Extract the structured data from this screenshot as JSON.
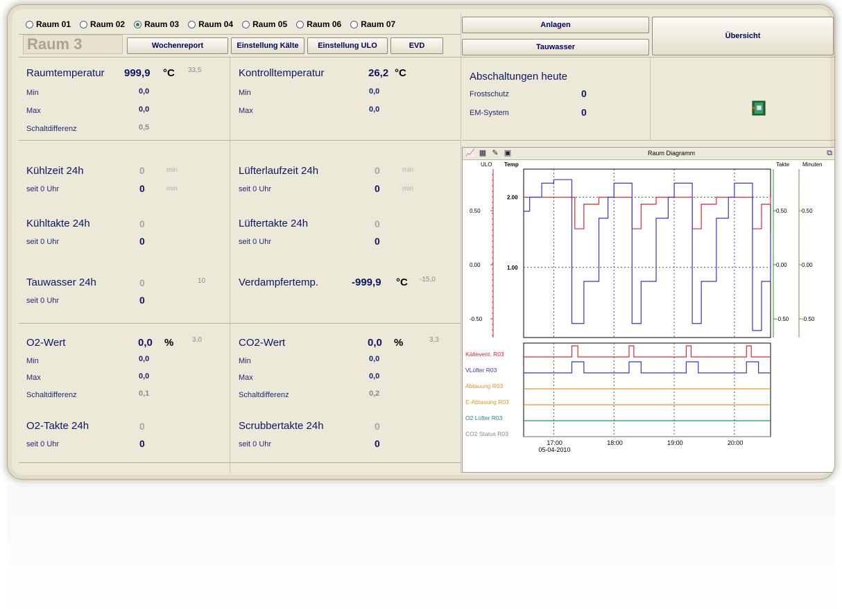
{
  "rooms": [
    {
      "label": "Raum 01",
      "selected": false
    },
    {
      "label": "Raum 02",
      "selected": false
    },
    {
      "label": "Raum 03",
      "selected": true
    },
    {
      "label": "Raum 04",
      "selected": false
    },
    {
      "label": "Raum 05",
      "selected": false
    },
    {
      "label": "Raum 06",
      "selected": false
    },
    {
      "label": "Raum 07",
      "selected": false
    }
  ],
  "header": {
    "room_title": "Raum 3",
    "btn_wochenreport": "Wochenreport",
    "btn_einstellung_kaelte": "Einstellung Kälte",
    "btn_einstellung_ulo": "Einstellung ULO",
    "btn_evd": "EVD",
    "btn_anlagen": "Anlagen",
    "btn_tauwasser": "Tauwasser",
    "btn_uebersicht": "Übersicht"
  },
  "raumtemp": {
    "title": "Raumtemperatur",
    "value": "999,9",
    "unit": "°C",
    "setpoint": "33,5",
    "min_label": "Min",
    "min": "0,0",
    "max_label": "Max",
    "max": "0,0",
    "diff_label": "Schaltdifferenz",
    "diff": "0,5"
  },
  "kontrolltemp": {
    "title": "Kontrolltemperatur",
    "value": "26,2",
    "unit": "°C",
    "min_label": "Min",
    "min": "0,0",
    "max_label": "Max",
    "max": "0,0"
  },
  "abschaltungen": {
    "title": "Abschaltungen heute",
    "frost_label": "Frostschutz",
    "frost": "0",
    "em_label": "EM-System",
    "em": "0"
  },
  "kuehlzeit": {
    "title": "Kühlzeit 24h",
    "value": "0",
    "unit": "min",
    "since_label": "seit 0 Uhr",
    "since": "0",
    "since_unit": "min"
  },
  "luefterlauf": {
    "title": "Lüfterlaufzeit 24h",
    "value": "0",
    "unit": "min",
    "since_label": "seit 0 Uhr",
    "since": "0",
    "since_unit": "min"
  },
  "kuehltakte": {
    "title": "Kühltakte 24h",
    "value": "0",
    "since_label": "seit 0 Uhr",
    "since": "0"
  },
  "luefertakte": {
    "title": "Lüftertakte 24h",
    "value": "0",
    "since_label": "seit 0 Uhr",
    "since": "0"
  },
  "tauwasser": {
    "title": "Tauwasser 24h",
    "value": "0",
    "setpoint": "10",
    "since_label": "seit 0 Uhr",
    "since": "0"
  },
  "verdampfer": {
    "title": "Verdampfertemp.",
    "value": "-999,9",
    "unit": "°C",
    "setpoint": "-15,0"
  },
  "o2": {
    "title": "O2-Wert",
    "value": "0,0",
    "unit": "%",
    "setpoint": "3,0",
    "min_label": "Min",
    "min": "0,0",
    "max_label": "Max",
    "max": "0,0",
    "diff_label": "Schaltdifferenz",
    "diff": "0,1"
  },
  "co2": {
    "title": "CO2-Wert",
    "value": "0,0",
    "unit": "%",
    "setpoint": "3,3",
    "min_label": "Min",
    "min": "0,0",
    "max_label": "Max",
    "max": "0,0",
    "diff_label": "Schaltdifferenz",
    "diff": "0,2"
  },
  "o2takte": {
    "title": "O2-Takte 24h",
    "value": "0",
    "since_label": "seit 0 Uhr",
    "since": "0"
  },
  "scrubber": {
    "title": "Scrubbertakte 24h",
    "value": "0",
    "since_label": "seit 0 Uhr",
    "since": "0"
  },
  "chart_data": {
    "type": "line",
    "title": "Raum Diagramm",
    "axis_labels": {
      "ulo": "ULO",
      "temp": "Temp",
      "takte": "Takte",
      "minuten": "Minuten"
    },
    "ulo_ticks": [
      "0.50",
      "0.00",
      "-0.50"
    ],
    "temp_ticks": [
      "2.00",
      "1.00"
    ],
    "takte_ticks": [
      "0.50",
      "0.00",
      "-0.50"
    ],
    "minuten_ticks": [
      "0.50",
      "0.00",
      "-0.50"
    ],
    "x_ticks": [
      "17:00",
      "18:00",
      "19:00",
      "20:00"
    ],
    "x_date": "05-04-2010",
    "colors": {
      "red": "#e8262b",
      "blue": "#3434e0",
      "orange": "#f0932a",
      "teal": "#1a8a8a",
      "grey": "#888888",
      "ulo_axis": "#c0282a",
      "takte_axis": "#2a9a2a",
      "minuten_axis": "#8a8a4a"
    },
    "series_temp_red": [
      [
        16.5,
        2.0
      ],
      [
        17.3,
        2.0
      ],
      [
        17.35,
        1.55
      ],
      [
        17.5,
        1.9
      ],
      [
        17.75,
        2.0
      ],
      [
        18.2,
        2.0
      ],
      [
        18.3,
        1.55
      ],
      [
        18.45,
        1.9
      ],
      [
        18.7,
        2.0
      ],
      [
        19.2,
        2.0
      ],
      [
        19.3,
        1.55
      ],
      [
        19.45,
        1.9
      ],
      [
        19.7,
        2.0
      ],
      [
        20.2,
        2.0
      ],
      [
        20.3,
        1.55
      ],
      [
        20.45,
        1.9
      ],
      [
        20.6,
        2.0
      ]
    ],
    "series_temp_blue": [
      [
        16.5,
        1.8
      ],
      [
        16.6,
        2.0
      ],
      [
        16.8,
        2.2
      ],
      [
        17.0,
        2.25
      ],
      [
        17.3,
        0.2
      ],
      [
        17.5,
        0.8
      ],
      [
        17.75,
        1.7
      ],
      [
        17.9,
        2.0
      ],
      [
        18.0,
        2.2
      ],
      [
        18.3,
        0.2
      ],
      [
        18.45,
        0.8
      ],
      [
        18.7,
        1.7
      ],
      [
        18.9,
        2.0
      ],
      [
        19.0,
        2.2
      ],
      [
        19.3,
        0.2
      ],
      [
        19.45,
        0.8
      ],
      [
        19.7,
        1.7
      ],
      [
        19.9,
        2.0
      ],
      [
        20.0,
        2.2
      ],
      [
        20.3,
        0.1
      ],
      [
        20.45,
        0.8
      ],
      [
        20.6,
        1.5
      ]
    ],
    "digital_series": [
      {
        "name": "Kältevent. R03",
        "color": "#e8262b",
        "pulses": [
          [
            17.3,
            17.4
          ],
          [
            18.25,
            18.33
          ],
          [
            19.2,
            19.28
          ],
          [
            20.2,
            20.28
          ]
        ]
      },
      {
        "name": "VLüfter R03",
        "color": "#3434e0",
        "pulses": [
          [
            17.3,
            17.5
          ],
          [
            18.25,
            18.45
          ],
          [
            19.2,
            19.4
          ],
          [
            20.2,
            20.4
          ]
        ]
      },
      {
        "name": "Abtauung R03",
        "color": "#f0932a",
        "pulses": []
      },
      {
        "name": "E-Abtauung R03",
        "color": "#f0932a",
        "pulses": []
      },
      {
        "name": "O2 Lüfter R03",
        "color": "#1a8a8a",
        "pulses": []
      },
      {
        "name": "CO2 Status R03",
        "color": "#888888",
        "pulses": []
      }
    ]
  }
}
